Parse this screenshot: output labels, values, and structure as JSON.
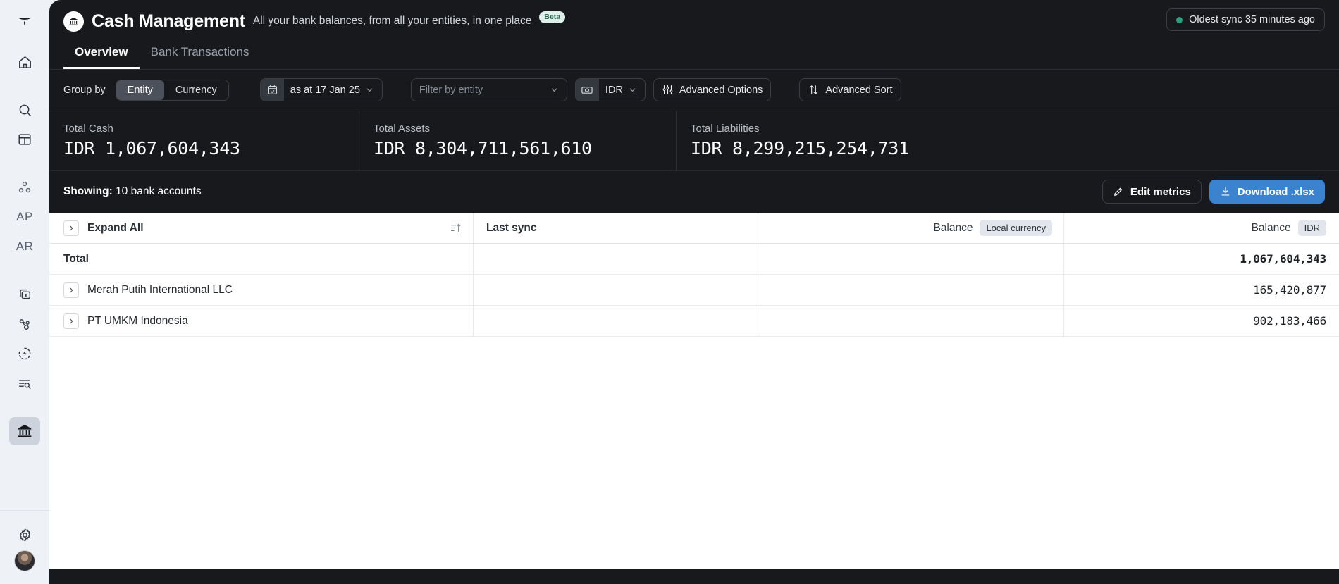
{
  "rail": {
    "logo_icon": "app-logo-icon",
    "items": [
      {
        "name": "home",
        "icon": "home-icon",
        "type": "icon"
      },
      {
        "name": "search",
        "icon": "search-icon",
        "type": "icon"
      },
      {
        "name": "tables",
        "icon": "table-grid-icon",
        "type": "icon"
      },
      {
        "name": "contacts",
        "icon": "people-nodes-icon",
        "type": "icon"
      },
      {
        "name": "accounts-payable",
        "label": "AP",
        "type": "text"
      },
      {
        "name": "accounts-receivable",
        "label": "AR",
        "type": "text"
      },
      {
        "name": "bills",
        "icon": "money-stack-icon",
        "type": "icon"
      },
      {
        "name": "network",
        "icon": "share-nodes-icon",
        "type": "icon"
      },
      {
        "name": "automation",
        "icon": "bolt-circle-icon",
        "type": "icon"
      },
      {
        "name": "reports-search",
        "icon": "list-search-icon",
        "type": "icon"
      },
      {
        "name": "cash-management",
        "icon": "bank-icon",
        "type": "icon",
        "active": true
      },
      {
        "name": "settings",
        "icon": "gear-icon",
        "type": "icon"
      }
    ],
    "avatar_label": "user-avatar"
  },
  "header": {
    "mark_icon": "bank-badge-icon",
    "title": "Cash Management",
    "subtitle": "All your bank balances, from all your entities, in one place",
    "badge": "Beta",
    "sync_status": "Oldest sync 35 minutes ago",
    "sync_dot_color": "#2f9e7f"
  },
  "tabs": [
    {
      "label": "Overview",
      "active": true
    },
    {
      "label": "Bank Transactions",
      "active": false
    }
  ],
  "toolbar": {
    "group_by_label": "Group by",
    "group_options": [
      {
        "label": "Entity",
        "active": true
      },
      {
        "label": "Currency",
        "active": false
      }
    ],
    "date_icon": "calendar-check-icon",
    "date_value": "as at 17 Jan 25",
    "entity_filter_placeholder": "Filter by entity",
    "entity_filter_value": "",
    "currency_icon": "banknote-icon",
    "currency_value": "IDR",
    "advanced_options_label": "Advanced Options",
    "advanced_options_icon": "sliders-icon",
    "advanced_sort_label": "Advanced Sort",
    "advanced_sort_icon": "arrows-up-down-icon"
  },
  "metrics": [
    {
      "label": "Total Cash",
      "value": "IDR 1,067,604,343"
    },
    {
      "label": "Total Assets",
      "value": "IDR 8,304,711,561,610"
    },
    {
      "label": "Total Liabilities",
      "value": "IDR 8,299,215,254,731"
    }
  ],
  "showbar": {
    "showing_label": "Showing:",
    "showing_value": "10 bank accounts",
    "edit_metrics_label": "Edit metrics",
    "edit_metrics_icon": "pencil-icon",
    "download_label": "Download .xlsx",
    "download_icon": "download-icon",
    "download_color": "#3b82cf"
  },
  "table": {
    "header": {
      "expand_all": "Expand All",
      "expand_icon": "chevron-right-icon",
      "sort_icon": "sort-ascending-icon",
      "last_sync": "Last sync",
      "balance_local": "Balance",
      "balance_local_chip": "Local currency",
      "balance_idr": "Balance",
      "balance_idr_chip": "IDR"
    },
    "rows": [
      {
        "name": "Total",
        "is_total": true,
        "expandable": false,
        "last_sync": "",
        "balance_local": "",
        "balance_idr": "1,067,604,343"
      },
      {
        "name": "Merah Putih International LLC",
        "is_total": false,
        "expandable": true,
        "last_sync": "",
        "balance_local": "",
        "balance_idr": "165,420,877"
      },
      {
        "name": "PT UMKM Indonesia",
        "is_total": false,
        "expandable": true,
        "last_sync": "",
        "balance_local": "",
        "balance_idr": "902,183,466"
      }
    ]
  }
}
